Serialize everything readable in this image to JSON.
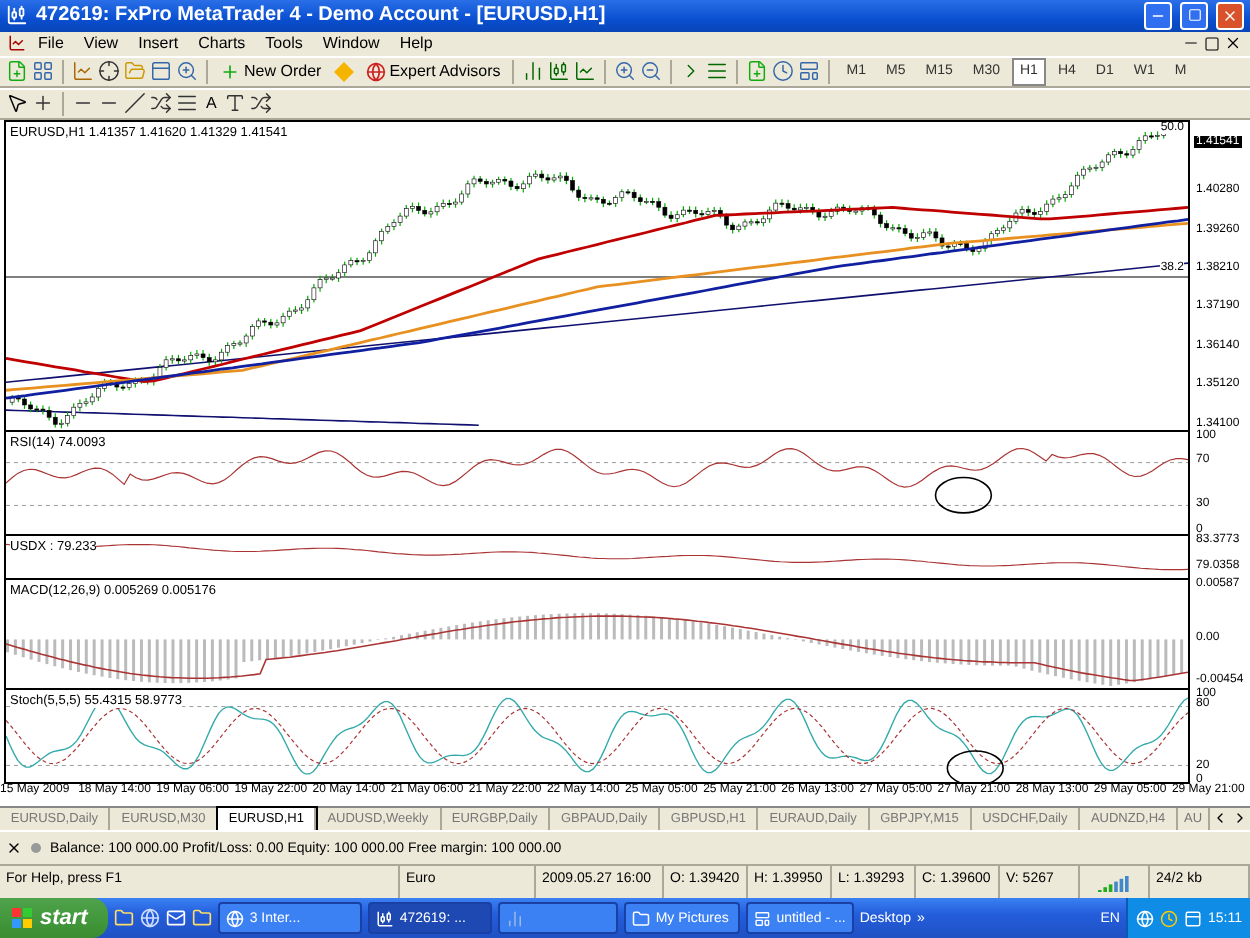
{
  "window": {
    "title": "472619: FxPro MetaTrader 4 - Demo Account - [EURUSD,H1]"
  },
  "menu": [
    "File",
    "View",
    "Insert",
    "Charts",
    "Tools",
    "Window",
    "Help"
  ],
  "toolbar": {
    "buttons": [
      {
        "label": "New Order"
      },
      {
        "label": "Expert Advisors"
      }
    ],
    "timeframes": [
      {
        "label": "M1",
        "selected": false
      },
      {
        "label": "M5",
        "selected": false
      },
      {
        "label": "M15",
        "selected": false
      },
      {
        "label": "M30",
        "selected": false
      },
      {
        "label": "H1",
        "selected": true
      },
      {
        "label": "H4",
        "selected": false
      },
      {
        "label": "D1",
        "selected": false
      },
      {
        "label": "W1",
        "selected": false
      },
      {
        "label": "M",
        "selected": false
      }
    ]
  },
  "drawing_toolbar": {
    "text_tool": "A"
  },
  "chart": {
    "legend": "EURUSD,H1  1.41357 1.41620 1.41329 1.41541",
    "current_price": "1.41541",
    "price_labels": [
      "1.40280",
      "1.39260",
      "1.38210",
      "1.37190",
      "1.36140",
      "1.35120",
      "1.34100"
    ],
    "fib_labels": [
      "50.0",
      "38.2"
    ]
  },
  "indicators": [
    {
      "kind": "rsi",
      "legend": "RSI(14) 74.0093",
      "axis": [
        "100",
        "70",
        "30",
        "0"
      ]
    },
    {
      "kind": "usdx",
      "legend": "USDX : 79.233",
      "axis": [
        "83.3773",
        "79.0358"
      ]
    },
    {
      "kind": "macd",
      "legend": "MACD(12,26,9) 0.005269 0.005176",
      "axis": [
        "0.00587",
        "0.00",
        "-0.00454"
      ]
    },
    {
      "kind": "stoch",
      "legend": "Stoch(5,5,5) 55.4315 58.9773",
      "axis": [
        "100",
        "80",
        "20",
        "0"
      ]
    }
  ],
  "time_axis": [
    "15 May 2009",
    "18 May 14:00",
    "19 May 06:00",
    "19 May 22:00",
    "20 May 14:00",
    "21 May 06:00",
    "21 May 22:00",
    "22 May 14:00",
    "25 May 05:00",
    "25 May 21:00",
    "26 May 13:00",
    "27 May 05:00",
    "27 May 21:00",
    "28 May 13:00",
    "29 May 05:00",
    "29 May 21:00"
  ],
  "chart_tabs": [
    {
      "label": "EURUSD,Daily",
      "selected": false
    },
    {
      "label": "EURUSD,M30",
      "selected": false
    },
    {
      "label": "EURUSD,H1",
      "selected": true
    },
    {
      "label": "AUDUSD,Weekly",
      "selected": false
    },
    {
      "label": "EURGBP,Daily",
      "selected": false
    },
    {
      "label": "GBPAUD,Daily",
      "selected": false
    },
    {
      "label": "GBPUSD,H1",
      "selected": false
    },
    {
      "label": "EURAUD,Daily",
      "selected": false
    },
    {
      "label": "GBPJPY,M15",
      "selected": false
    },
    {
      "label": "USDCHF,Daily",
      "selected": false
    },
    {
      "label": "AUDNZD,H4",
      "selected": false
    },
    {
      "label": "AU",
      "selected": false
    }
  ],
  "terminal": {
    "summary": "Balance: 100 000.00  Profit/Loss: 0.00  Equity: 100 000.00  Free margin: 100 000.00"
  },
  "status_bar": {
    "help": "For Help, press F1",
    "profile": "Euro",
    "datetime": "2009.05.27 16:00",
    "open": "O: 1.39420",
    "high": "H: 1.39950",
    "low": "L: 1.39293",
    "close": "C: 1.39600",
    "volume": "V: 5267",
    "traffic": "24/2 kb"
  },
  "taskbar": {
    "start": "start",
    "tasks": [
      {
        "label": "3 Inter...",
        "selected": false
      },
      {
        "label": "472619: ...",
        "selected": true
      },
      {
        "label": "My Pictures",
        "selected": false
      },
      {
        "label": "untitled - ...",
        "selected": false
      }
    ],
    "desktop": "Desktop",
    "chevron": "»",
    "language": "EN",
    "clock": "15:11"
  }
}
